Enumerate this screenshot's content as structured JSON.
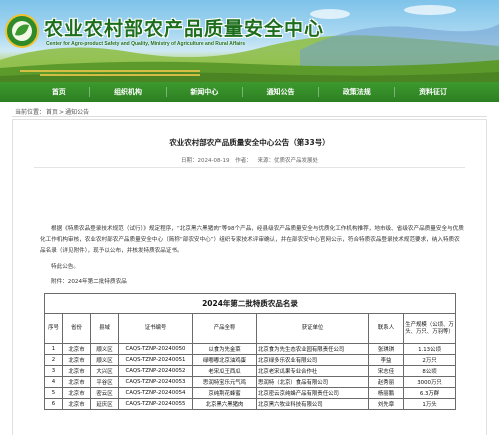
{
  "site": {
    "title": "农业农村部农产品质量安全中心",
    "subtitle": "Center for Agro-product Safety and Quality, Ministry of Agriculture and Rural Affairs"
  },
  "nav": {
    "items": [
      "首页",
      "组织机构",
      "新闻中心",
      "通知公告",
      "政策法规",
      "资料征订"
    ]
  },
  "breadcrumb": {
    "prefix": "当前位置：",
    "home": "首页",
    "sep": ">",
    "current": "通知公告"
  },
  "article": {
    "title": "农业农村部农产品质量安全中心公告（第33号）",
    "date": "日期：2024-08-19",
    "views": "作者：",
    "source": "来源：优质农产品发展处",
    "para1": "根据《特质农品登录技术规范（试行）》规定程序，“北京黑六黑猪肉”等98个产品，经县级农产品质量安全与优质化工作机构推荐，地市级、省级农产品质量安全与优质化工作机构审核，农业农村部农产品质量安全中心（简称“部农安中心”）组织专家技术评审确认，并在部农安中心官网公示，符合特质农品登录技术规范要求，纳入特质农品名录（详见附件），现予以公布，并核发特质农品证书。",
    "para2": "特此公告。",
    "para3": "附件：2024年第二批特质农品"
  },
  "table": {
    "caption": "2024年第二批特质农品名录",
    "headers": [
      "序号",
      "省份",
      "县域",
      "证书编号",
      "产品全称",
      "获证单位",
      "联系人",
      "生产规模（公顷、万头、万只、万羽等）"
    ],
    "rows": [
      [
        "1",
        "北京市",
        "顺义区",
        "CAQS-TZNP-20240050",
        "以食为先金菜",
        "北京食为先生态农业园有限责任公司",
        "张琪琪",
        "1.13公顷"
      ],
      [
        "2",
        "北京市",
        "顺义区",
        "CAQS-TZNP-20240051",
        "绿嘟嘟北京油鸡蛋",
        "北京绿多乐农业有限公司",
        "李益",
        "2万只"
      ],
      [
        "3",
        "北京市",
        "大兴区",
        "CAQS-TZNP-20240052",
        "老宋瓜王西瓜",
        "北京老宋瓜果专业合作社",
        "宋志佳",
        "8公顷"
      ],
      [
        "4",
        "北京市",
        "平谷区",
        "CAQS-TZNP-20240053",
        "思润特宝乐元气鸡",
        "思润特（北京）食品有限公司",
        "赵秀丽",
        "3000万只"
      ],
      [
        "5",
        "北京市",
        "密云区",
        "CAQS-TZNP-20240054",
        "京纯荆花蜂蜜",
        "北京密云京纯蜂产品有限责任公司",
        "杨丽鹏",
        "6.3万群"
      ],
      [
        "6",
        "北京市",
        "延庆区",
        "CAQS-TZNP-20240055",
        "北京黑六黑猪肉",
        "北京黑六牧业科技有限公司",
        "刘先章",
        "1万头"
      ]
    ]
  },
  "colors": {
    "nav_green": "#2d7f22",
    "title_green": "#1d6e1c"
  }
}
